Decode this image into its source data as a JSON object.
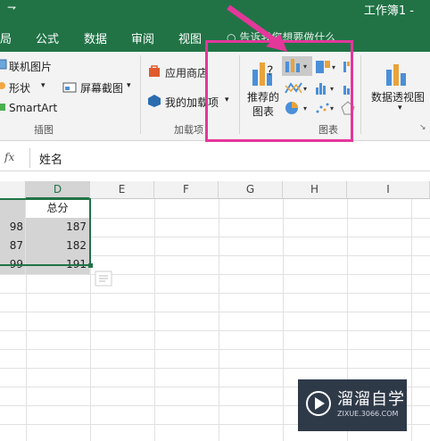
{
  "title_bar": {
    "title": "工作簿1 -",
    "quick_access_glyph": "⇁"
  },
  "tabs": [
    "局",
    "公式",
    "数据",
    "审阅",
    "视图"
  ],
  "tell_me": {
    "icon": "lightbulb-icon",
    "text": "告诉我您想要做什么"
  },
  "ribbon": {
    "illustrations": {
      "online_pictures": "联机图片",
      "shapes": "形状",
      "screenshot": "屏幕截图",
      "smartart": "SmartArt",
      "group_label": "插图"
    },
    "addins": {
      "store": "应用商店",
      "my_addins": "我的加载项",
      "group_label": "加载项"
    },
    "charts": {
      "recommended_line1": "推荐的",
      "recommended_line2": "图表",
      "group_label": "图表",
      "pivot_chart": "数据透视图"
    }
  },
  "formula_bar": {
    "fx": "fx",
    "value": "姓名"
  },
  "columns": [
    "D",
    "E",
    "F",
    "G",
    "H",
    "I"
  ],
  "grid": {
    "header_row": {
      "d": "总分"
    },
    "rows": [
      {
        "c": "98",
        "d": "187"
      },
      {
        "c": "87",
        "d": "182"
      },
      {
        "c": "99",
        "d": "191"
      }
    ]
  },
  "watermark": {
    "brand": "溜溜自学",
    "url": "ZIXUE.3066.COM"
  },
  "colors": {
    "excel_green": "#217346",
    "highlight_pink": "#e4379a",
    "selection_fill": "#d4d4d4"
  }
}
